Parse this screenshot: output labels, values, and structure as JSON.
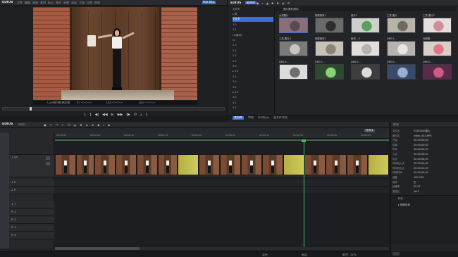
{
  "app": {
    "name": "EDIUS"
  },
  "player": {
    "menu": [
      "文件",
      "编辑",
      "视图",
      "素材",
      "标记",
      "模式",
      "采集",
      "渲染",
      "工具",
      "设置",
      "帮助"
    ],
    "mode_label": "PLR REC",
    "timecode": "00:00:00;00",
    "cue_label": "Cue",
    "cue_time": "00:00:00;00",
    "in_label": "In",
    "in_time": "--:--:--;--",
    "out_label": "Out",
    "out_time": "--:--:--;--",
    "dur_label": "Dur",
    "dur_time": "--:--:--;--"
  },
  "bin": {
    "title": "EDIUS",
    "tab": "素材库",
    "path": "图片素材/图片",
    "folder_tree_title": "文件夹",
    "folders": [
      "▸ 根",
      "  文件夹",
      "  1.0",
      "  1.1",
      "  t1(素材)",
      "  t2",
      "  2.0",
      "  2.1",
      "  2.2",
      "  2.3",
      "  3.0",
      "  ▸ 3.1",
      "  3.2",
      "  3.3",
      "  3.4",
      "  ▸ 3.5",
      "  4.0",
      "  4.1",
      "  4.2"
    ],
    "thumbs": [
      {
        "label": "女孩照片"
      },
      {
        "label": "视频素材1"
      },
      {
        "label": "音乐1"
      },
      {
        "label": "工具 图片"
      },
      {
        "label": "工具 图片2"
      },
      {
        "label": "工具 图片3"
      },
      {
        "label": "视频素材2"
      },
      {
        "label": "素材 ...3"
      },
      {
        "label": "DBS-0..."
      },
      {
        "label": "光照图..."
      },
      {
        "label": "DBS-0..."
      },
      {
        "label": "DBS-0..."
      },
      {
        "label": "DBS-0..."
      },
      {
        "label": "DBS-0..."
      },
      {
        "label": "DBS-0..."
      }
    ],
    "bottom_tabs": [
      "素材库",
      "特效",
      "序列标记",
      "源文件浏览"
    ]
  },
  "timeline": {
    "title": "EDIUS",
    "seq_name": "序列1",
    "tabs": [
      "序列1"
    ],
    "ruler": [
      "00:00:00",
      "00:00:05",
      "00:00:10",
      "00:00:15",
      "00:00:20",
      "00:00:25",
      "00:00:30",
      "00:00:35",
      "00:00:40",
      "00:00:45"
    ],
    "tracks": [
      {
        "name": "1 VA",
        "kind": "video"
      },
      {
        "name": "1 A",
        "kind": "audio"
      },
      {
        "name": "2 A",
        "kind": "audio"
      },
      {
        "name": "1 T",
        "kind": "title"
      },
      {
        "name": "A 1",
        "kind": "audio"
      },
      {
        "name": "A 2",
        "kind": "audio"
      },
      {
        "name": "A 3",
        "kind": "audio"
      },
      {
        "name": "A 4",
        "kind": "audio"
      }
    ],
    "status_left": "暂停",
    "status_mid": "磁盘",
    "status_right": "剩余: 33%"
  },
  "properties": {
    "title": "信息",
    "rows": [
      {
        "k": "文件名",
        "v": "G:\\EDIUS\\图片"
      },
      {
        "k": "素材名",
        "v": "video_002.MP4"
      },
      {
        "k": "开始",
        "v": "00:00:00;00"
      },
      {
        "k": "结束",
        "v": "00:00:00;00"
      },
      {
        "k": "时长",
        "v": "00:00:00;00"
      },
      {
        "k": "入点",
        "v": "00:00:00;00"
      },
      {
        "k": "出点",
        "v": "00:00:00;00"
      },
      {
        "k": "时间线入点",
        "v": "00:00:00;00"
      },
      {
        "k": "时间线出点",
        "v": "00:00:00;00"
      },
      {
        "k": "持续时间",
        "v": "00:00:00;00"
      },
      {
        "k": "速度",
        "v": "100.00%"
      },
      {
        "k": "场序",
        "v": "无"
      },
      {
        "k": "帧速率",
        "v": "29.97"
      },
      {
        "k": "宽高比",
        "v": "16:9"
      }
    ],
    "effects_title": "特效",
    "effect_item": "▸ 视频布局"
  },
  "colors": {
    "accent_blue": "#3a6fd8",
    "clip_yellow": "#b4b044",
    "cursor_green": "#3dbb62"
  }
}
